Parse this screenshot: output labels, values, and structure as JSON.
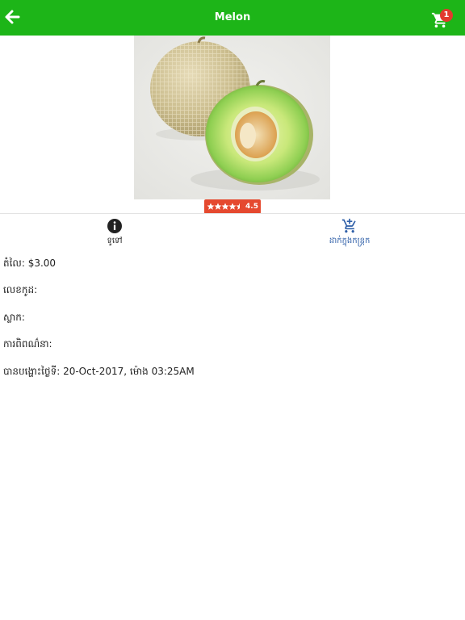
{
  "header": {
    "title": "Melon",
    "back_icon": "arrow-left-icon",
    "cart_icon": "shopping-cart-icon",
    "cart_count": "1",
    "background_color": "#1db518"
  },
  "product": {
    "image_icon": "melon-photo",
    "rating": 4.5,
    "rating_label": "4.5",
    "rating_color": "#e5492f"
  },
  "actions": {
    "detail": {
      "label": "ទូទៅ",
      "icon": "info-circle-icon"
    },
    "cart": {
      "label": "ដាក់ក្នុងកន្ត្រក",
      "icon": "add-cart-icon",
      "color": "#2f5fa8"
    }
  },
  "details": {
    "price": "តំលៃ: $3.00",
    "code": "លេខកូដ:",
    "brand": "ស្លាក:",
    "description": "ការពិពណ៌នា:",
    "posted": "បានបង្ហោះថ្ងៃទី: 20-Oct-2017, ម៉ោង 03:25AM"
  }
}
